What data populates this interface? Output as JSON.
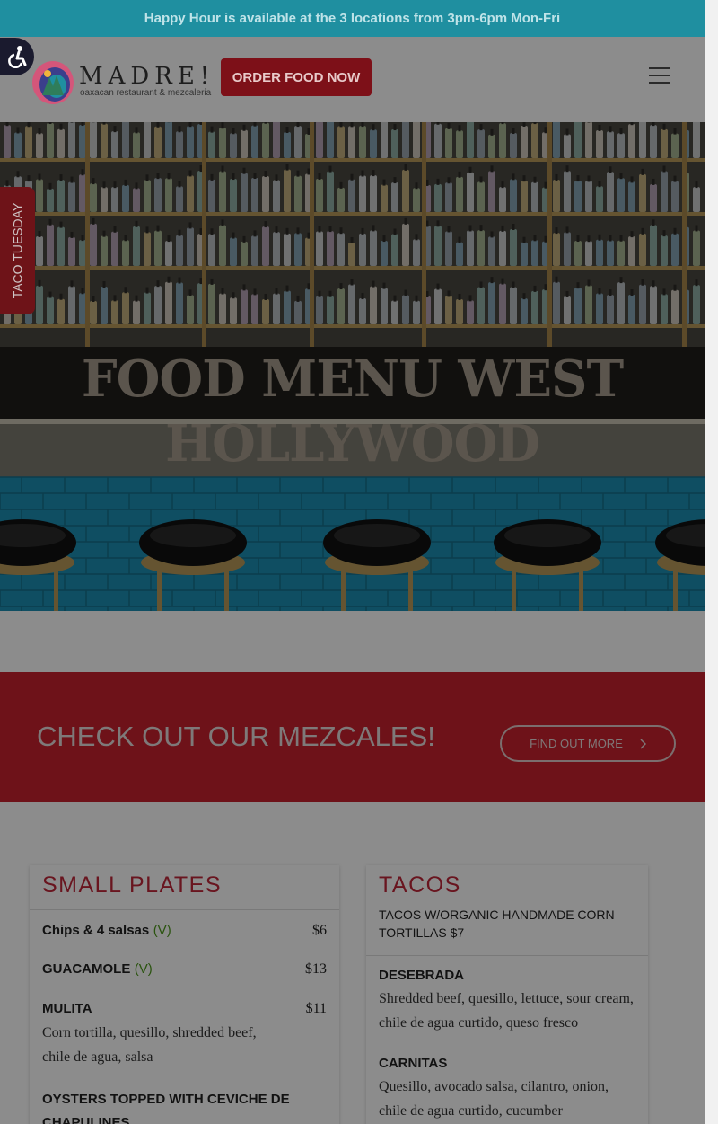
{
  "promo": {
    "text": "Happy Hour is available at the 3 locations from 3pm-6pm Mon-Fri"
  },
  "header": {
    "logo_word": "MADRE!",
    "logo_sub": "oaxacan restaurant & mezcaleria",
    "order_label": "ORDER FOOD NOW",
    "accessibility_icon": "accessibility-icon",
    "menu_icon": "hamburger-menu-icon"
  },
  "side_tab": {
    "label": "TACO TUESDAY"
  },
  "hero": {
    "title_line1": "FOOD MENU WEST",
    "title_line2": "HOLLYWOOD"
  },
  "mezcal": {
    "title": "CHECK OUT OUR MEZCALES!",
    "button_label": "FIND OUT MORE",
    "button_icon": "chevron-right-icon"
  },
  "small_plates": {
    "title": "SMALL PLATES",
    "items": [
      {
        "name": "Chips & 4 salsas",
        "tag": "(V)",
        "price": "$6",
        "desc": ""
      },
      {
        "name": "GUACAMOLE",
        "tag": "(V)",
        "price": "$13",
        "desc": ""
      },
      {
        "name": "MULITA",
        "tag": "",
        "price": "$11",
        "desc": "Corn tortilla, quesillo, shredded beef, chile de agua, salsa"
      },
      {
        "name": "OYSTERS TOPPED WITH CEVICHE DE CHAPULINES",
        "tag": "",
        "price": "",
        "desc": ""
      }
    ]
  },
  "tacos": {
    "title": "TACOS",
    "note": "TACOS W/ORGANIC HANDMADE CORN TORTILLAS $7",
    "items": [
      {
        "name": "DESEBRADA",
        "desc": "Shredded beef, quesillo, lettuce, sour cream, chile de agua curtido, queso fresco"
      },
      {
        "name": "CARNITAS",
        "desc": "Quesillo, avocado salsa, cilantro, onion, chile de agua curtido, cucumber"
      }
    ]
  },
  "colors": {
    "promo_bg": "#1f8fa0",
    "brand_red": "#c8222e",
    "order_bg": "#7d1018",
    "veg_green": "#4f9a1e"
  }
}
